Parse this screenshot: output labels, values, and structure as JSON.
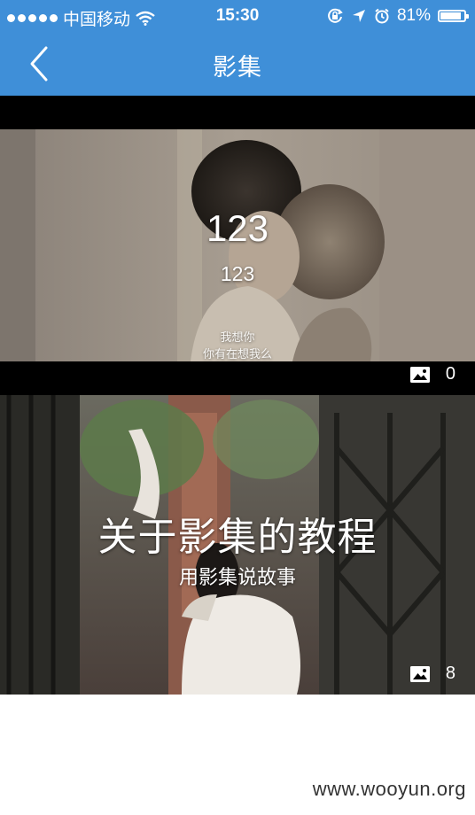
{
  "status_bar": {
    "carrier": "中国移动",
    "time": "15:30",
    "battery": "81%",
    "battery_level": 0.81
  },
  "nav": {
    "title": "影集"
  },
  "albums": [
    {
      "title": "123",
      "subtitle": "123",
      "caption_line1": "我想你",
      "caption_line2": "你有在想我么",
      "count": "0"
    },
    {
      "title": "关于影集的教程",
      "subtitle": "用影集说故事",
      "count": "8"
    }
  ],
  "watermark": "www.wooyun.org",
  "colors": {
    "accent": "#3f8fd8",
    "background": "#ffffff"
  }
}
